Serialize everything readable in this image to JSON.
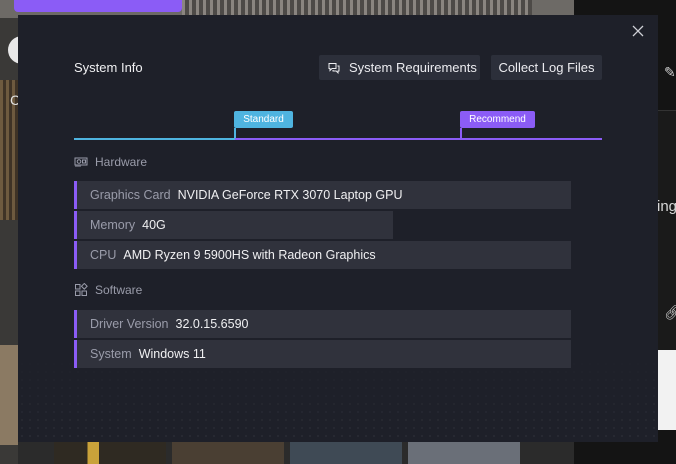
{
  "modal": {
    "title": "System Info",
    "buttons": {
      "system_requirements": "System Requirements",
      "collect_logs": "Collect Log Files"
    },
    "tiers": {
      "standard": "Standard",
      "recommend": "Recommend"
    },
    "hardware": {
      "heading": "Hardware",
      "rows": [
        {
          "label": "Graphics Card",
          "value": "NVIDIA GeForce RTX 3070 Laptop GPU"
        },
        {
          "label": "Memory",
          "value": "40G"
        },
        {
          "label": "CPU",
          "value": "AMD Ryzen 9 5900HS with Radeon Graphics"
        }
      ]
    },
    "software": {
      "heading": "Software",
      "rows": [
        {
          "label": "Driver Version",
          "value": "32.0.15.6590"
        },
        {
          "label": "System",
          "value": "Windows 11"
        }
      ]
    }
  },
  "background": {
    "left_letter": "C",
    "right_text": "ing"
  },
  "icons": {
    "close": "close-icon",
    "chat": "chat-bubbles-icon",
    "hardware": "gpu-icon",
    "software": "apps-grid-icon",
    "edit": "pencil-icon",
    "link": "link-icon"
  },
  "colors": {
    "modal_bg": "#1e2029",
    "row_bg": "#30323c",
    "accent_purple": "#8b5cf6",
    "accent_blue": "#4fb4e0"
  }
}
